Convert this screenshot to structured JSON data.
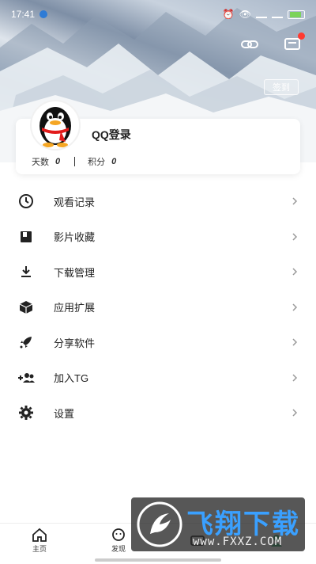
{
  "status_bar": {
    "time": "17:41"
  },
  "header": {
    "signin_label": "签到"
  },
  "profile": {
    "name": "QQ登录",
    "days_label": "天数",
    "days_value": "0",
    "points_label": "积分",
    "points_value": "0"
  },
  "menu": [
    {
      "label": "观看记录",
      "icon": "clock-icon"
    },
    {
      "label": "影片收藏",
      "icon": "bookmark-icon"
    },
    {
      "label": "下载管理",
      "icon": "download-icon"
    },
    {
      "label": "应用扩展",
      "icon": "cube-icon"
    },
    {
      "label": "分享软件",
      "icon": "rocket-icon"
    },
    {
      "label": "加入TG",
      "icon": "add-group-icon"
    },
    {
      "label": "设置",
      "icon": "gear-icon"
    }
  ],
  "bottom_nav": [
    {
      "label": "主页",
      "icon": "home-icon"
    },
    {
      "label": "发现",
      "icon": "discover-icon"
    },
    {
      "label": "",
      "icon": "tv-icon"
    },
    {
      "label": "",
      "icon": "user-icon"
    }
  ],
  "watermark": {
    "title": "飞翔下载",
    "url": "www.FXXZ.COM"
  },
  "colors": {
    "active_tab": "#2fa56b",
    "badge": "#ff3a30"
  }
}
